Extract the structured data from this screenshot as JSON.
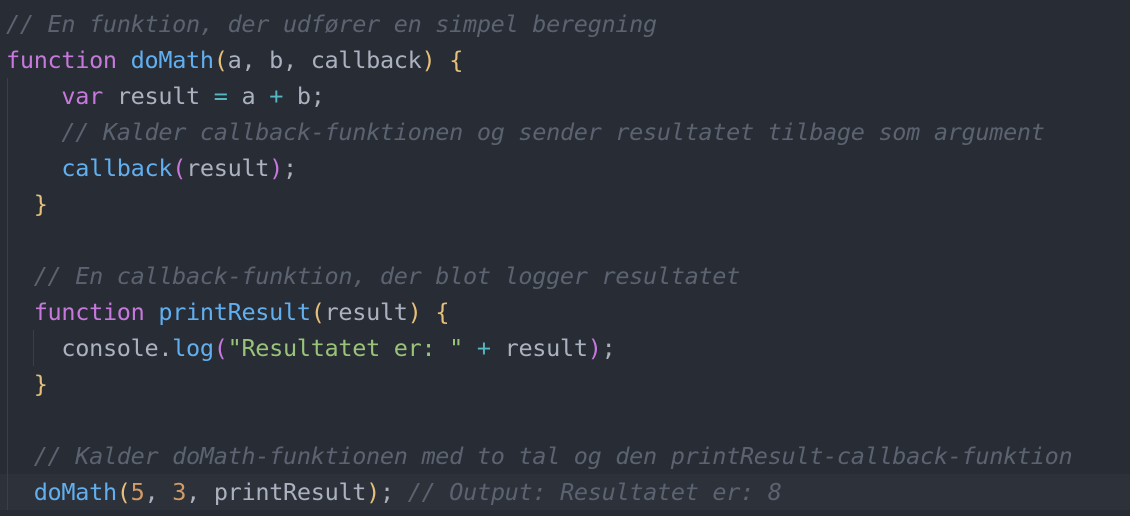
{
  "code": {
    "l1_comment": "// En funktion, der udfører en simpel beregning",
    "l2_keyword": "function",
    "l2_name": "doMath",
    "l2_open": "(",
    "l2_params": "a, b, callback",
    "l2_close": ")",
    "l2_brace": "{",
    "l3_keyword": "var",
    "l3_var": "result",
    "l3_eq": "=",
    "l3_a": "a",
    "l3_plus": "+",
    "l3_b": "b;",
    "l4_comment": "// Kalder callback-funktionen og sender resultatet tilbage som argument",
    "l5_call": "callback",
    "l5_open": "(",
    "l5_arg": "result",
    "l5_close": ")",
    "l5_semi": ";",
    "l6_brace": "}",
    "l8_comment": "// En callback-funktion, der blot logger resultatet",
    "l9_keyword": "function",
    "l9_name": "printResult",
    "l9_open": "(",
    "l9_param": "result",
    "l9_close": ")",
    "l9_brace": "{",
    "l10_obj": "console.",
    "l10_method": "log",
    "l10_open": "(",
    "l10_string": "\"Resultatet er: \"",
    "l10_plus": "+",
    "l10_arg": "result",
    "l10_close": ")",
    "l10_semi": ";",
    "l11_brace": "}",
    "l13_comment": "// Kalder doMath-funktionen med to tal og den printResult-callback-funktion",
    "l14_call": "doMath",
    "l14_open": "(",
    "l14_n1": "5",
    "l14_comma1": ",",
    "l14_n2": "3",
    "l14_comma2": ",",
    "l14_arg": "printResult",
    "l14_close": ")",
    "l14_semi": ";",
    "l14_comment": "// Output: Resultatet er: 8"
  },
  "colors": {
    "background": "#282c34",
    "comment": "#5c6370",
    "keyword": "#c678dd",
    "function": "#61afef",
    "bracket": "#e5c07b",
    "operator": "#56b6c2",
    "number": "#d19a66",
    "string": "#98c379",
    "plain": "#abb2bf"
  }
}
